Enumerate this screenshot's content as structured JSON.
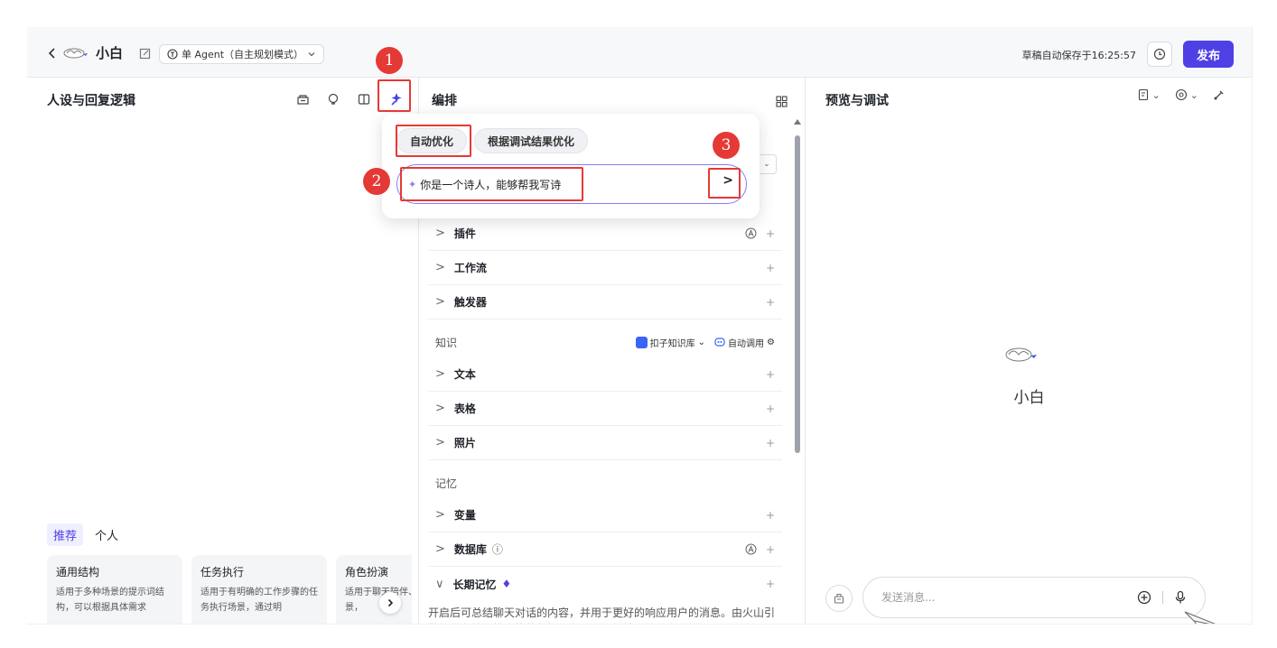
{
  "header": {
    "agent_name": "小白",
    "mode_label": "单 Agent（自主规划模式）",
    "save_status": "草稿自动保存于16:25:57",
    "publish_label": "发布"
  },
  "left": {
    "title": "人设与回复逻辑",
    "tabs": [
      {
        "label": "推荐"
      },
      {
        "label": "个人"
      }
    ],
    "cards": [
      {
        "title": "通用结构",
        "desc": "适用于多种场景的提示词结构，可以根据具体需求"
      },
      {
        "title": "任务执行",
        "desc": "适用于有明确的工作步骤的任务执行场景，通过明"
      },
      {
        "title": "角色扮演",
        "desc": "适用于聊天陪伴、互动娱乐场景，"
      }
    ]
  },
  "middle": {
    "title": "编排",
    "skills": [
      {
        "label": "插件"
      },
      {
        "label": "工作流"
      },
      {
        "label": "触发器"
      }
    ],
    "knowledge": {
      "label": "知识",
      "kb_label": "扣子知识库",
      "call_label": "自动调用",
      "items": [
        {
          "label": "文本"
        },
        {
          "label": "表格"
        },
        {
          "label": "照片"
        }
      ]
    },
    "memory": {
      "label": "记忆",
      "items": [
        {
          "label": "变量"
        },
        {
          "label": "数据库"
        },
        {
          "label": "长期记忆"
        }
      ]
    },
    "long_memory_desc": "开启后可总结聊天对话的内容，并用于更好的响应用户的消息。由火山引擎提供存储及检索等的数据服务，以更好地记住用户偏好。"
  },
  "popup": {
    "tab_auto": "自动优化",
    "tab_debug": "根据调试结果优化",
    "input_value": "你是一个诗人，能够帮我写诗",
    "send_glyph": ">"
  },
  "right": {
    "title": "预览与调试",
    "bot_name": "小白",
    "msg_placeholder": "发送消息..."
  },
  "annotations": [
    "1",
    "2",
    "3"
  ],
  "colors": {
    "accent": "#4e40e5",
    "annotation": "#e53935"
  }
}
